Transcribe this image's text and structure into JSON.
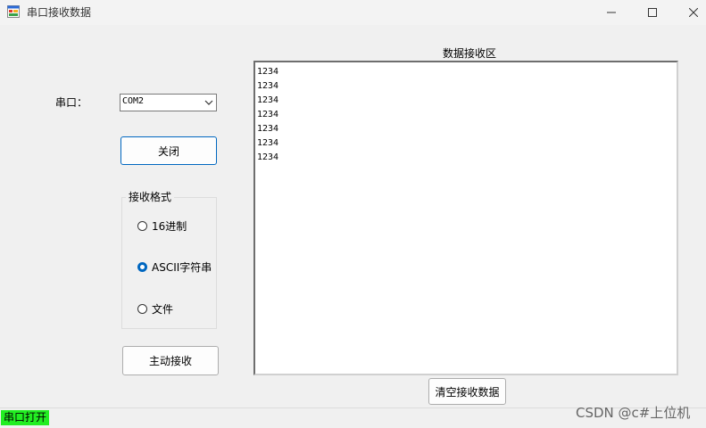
{
  "window": {
    "title": "串口接收数据",
    "icons": {
      "app": "form-icon",
      "minimize": "minimize-icon",
      "maximize": "maximize-icon",
      "close": "close-icon"
    }
  },
  "port": {
    "label": "串口：",
    "selected": "COM2"
  },
  "buttons": {
    "close_port": "关闭",
    "active_receive": "主动接收",
    "clear_receive": "清空接收数据"
  },
  "format": {
    "legend": "接收格式",
    "options": [
      {
        "label": "16进制",
        "checked": false
      },
      {
        "label": "ASCII字符串",
        "checked": true
      },
      {
        "label": "文件",
        "checked": false
      }
    ]
  },
  "receive": {
    "title": "数据接收区",
    "lines": [
      "1234",
      "1234",
      "1234",
      "1234",
      "1234",
      "1234",
      "1234"
    ]
  },
  "status": {
    "text": "串口打开",
    "color": "#22ee22"
  },
  "watermark": "CSDN @c#上位机"
}
